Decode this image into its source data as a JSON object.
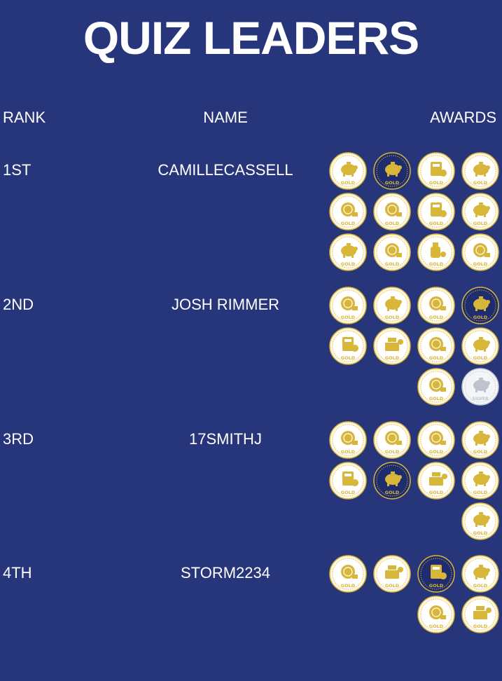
{
  "page": {
    "title": "QUIZ LEADERS",
    "background": "#27367a"
  },
  "headers": {
    "rank": "RANK",
    "name": "NAME",
    "awards": "AWARDS"
  },
  "colors": {
    "gold_fill": "#d8b63a",
    "gold_ring": "#fdf7e2",
    "dark_fill": "#1f2c6e",
    "silver_fill": "#bfc3cc",
    "silver_ring": "#f4f5f7"
  },
  "leaders": [
    {
      "rank": "1ST",
      "name": "CAMILLECASSELL",
      "awards": [
        {
          "kind": "gold",
          "label": "GOLD",
          "icon": "piggy-bank-medal-icon"
        },
        {
          "kind": "gold-dark",
          "label": "GOLD",
          "icon": "piggy-bank-medal-icon"
        },
        {
          "kind": "gold",
          "label": "GOLD",
          "icon": "calculator-medal-icon"
        },
        {
          "kind": "gold",
          "label": "GOLD",
          "icon": "piggy-bank-medal-icon"
        },
        {
          "kind": "gold",
          "label": "GOLD",
          "icon": "coins-medal-icon"
        },
        {
          "kind": "gold",
          "label": "GOLD",
          "icon": "coins-medal-icon"
        },
        {
          "kind": "gold",
          "label": "GOLD",
          "icon": "calculator-medal-icon"
        },
        {
          "kind": "gold",
          "label": "GOLD",
          "icon": "piggy-bank-medal-icon"
        },
        {
          "kind": "gold",
          "label": "GOLD",
          "icon": "piggy-bank-medal-icon"
        },
        {
          "kind": "gold",
          "label": "GOLD",
          "icon": "coins-medal-icon"
        },
        {
          "kind": "gold",
          "label": "GOLD",
          "icon": "bottle-medal-icon"
        },
        {
          "kind": "gold",
          "label": "GOLD",
          "icon": "coins-medal-icon"
        }
      ]
    },
    {
      "rank": "2ND",
      "name": "JOSH RIMMER",
      "awards": [
        {
          "kind": "gold",
          "label": "GOLD",
          "icon": "coins-medal-icon"
        },
        {
          "kind": "gold",
          "label": "GOLD",
          "icon": "piggy-bank-medal-icon"
        },
        {
          "kind": "gold",
          "label": "GOLD",
          "icon": "coins-medal-icon"
        },
        {
          "kind": "gold-dark",
          "label": "GOLD",
          "icon": "piggy-bank-medal-icon"
        },
        {
          "kind": "gold",
          "label": "GOLD",
          "icon": "calculator-medal-icon"
        },
        {
          "kind": "gold",
          "label": "GOLD",
          "icon": "cash-register-medal-icon"
        },
        {
          "kind": "gold",
          "label": "GOLD",
          "icon": "coins-medal-icon"
        },
        {
          "kind": "gold",
          "label": "GOLD",
          "icon": "piggy-bank-medal-icon"
        },
        {
          "kind": "gold",
          "label": "GOLD",
          "icon": "coins-medal-icon"
        },
        {
          "kind": "silver",
          "label": "SILVER",
          "icon": "piggy-bank-medal-icon"
        }
      ]
    },
    {
      "rank": "3RD",
      "name": "17SMITHJ",
      "awards": [
        {
          "kind": "gold",
          "label": "GOLD",
          "icon": "coins-medal-icon"
        },
        {
          "kind": "gold",
          "label": "GOLD",
          "icon": "coins-medal-icon"
        },
        {
          "kind": "gold",
          "label": "GOLD",
          "icon": "coins-medal-icon"
        },
        {
          "kind": "gold",
          "label": "GOLD",
          "icon": "piggy-bank-medal-icon"
        },
        {
          "kind": "gold",
          "label": "GOLD",
          "icon": "calculator-medal-icon"
        },
        {
          "kind": "gold-dark",
          "label": "GOLD",
          "icon": "piggy-bank-medal-icon"
        },
        {
          "kind": "gold",
          "label": "GOLD",
          "icon": "cash-register-medal-icon"
        },
        {
          "kind": "gold",
          "label": "GOLD",
          "icon": "piggy-bank-medal-icon"
        },
        {
          "kind": "gold",
          "label": "GOLD",
          "icon": "piggy-bank-medal-icon"
        }
      ]
    },
    {
      "rank": "4TH",
      "name": "STORM2234",
      "awards": [
        {
          "kind": "gold",
          "label": "GOLD",
          "icon": "coins-medal-icon"
        },
        {
          "kind": "gold",
          "label": "GOLD",
          "icon": "cash-register-medal-icon"
        },
        {
          "kind": "gold-dark",
          "label": "GOLD",
          "icon": "calculator-medal-icon"
        },
        {
          "kind": "gold",
          "label": "GOLD",
          "icon": "piggy-bank-medal-icon"
        },
        {
          "kind": "gold",
          "label": "GOLD",
          "icon": "coins-medal-icon"
        },
        {
          "kind": "gold",
          "label": "GOLD",
          "icon": "cash-register-medal-icon"
        }
      ]
    }
  ]
}
